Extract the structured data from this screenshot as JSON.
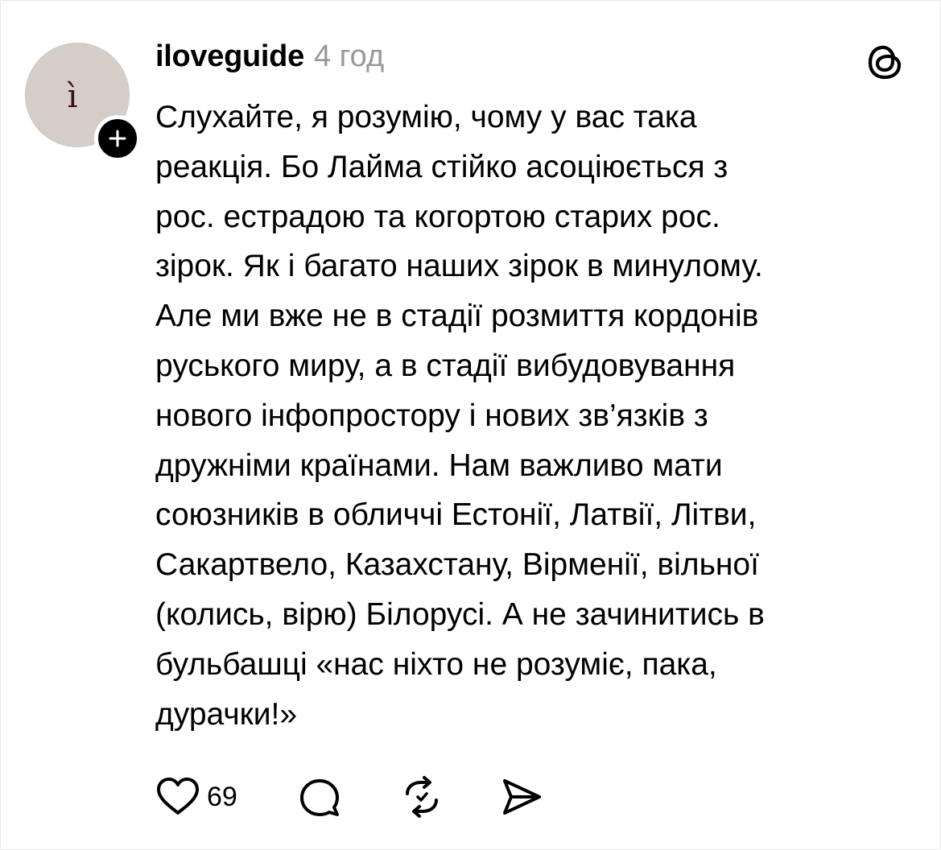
{
  "post": {
    "username": "iloveguide",
    "time": "4 год",
    "avatar_letter": "ì",
    "text": "Слухайте, я розумію, чому у вас така\nреакція. Бо Лайма стійко асоціюється з\nрос. естрадою та когортою старих рос.\nзірок. Як і багато наших зірок в минулому.\nАле ми вже не в стадії розмиття кордонів\nруського миру, а в стадії вибудовування\nнового інфопростору і нових зв’язків з\nдружніми країнами. Нам важливо мати\nсоюзників в обличчі Естонії, Латвії, Літви,\nСакартвело, Казахстану, Вірменії, вільної\n(колись, вірю) Білорусі. А не зачинитись в\nбульбашці «нас ніхто не розуміє, пака,\nдурачки!»",
    "like_count": "69"
  },
  "icons": {
    "follow": "plus-icon",
    "brand": "threads-logo-icon",
    "like": "heart-icon",
    "reply": "comment-icon",
    "repost": "repost-icon",
    "share": "share-icon"
  },
  "colors": {
    "text": "#000000",
    "muted": "#999999",
    "avatar_bg": "#d4cdc8",
    "badge_bg": "#000000"
  }
}
